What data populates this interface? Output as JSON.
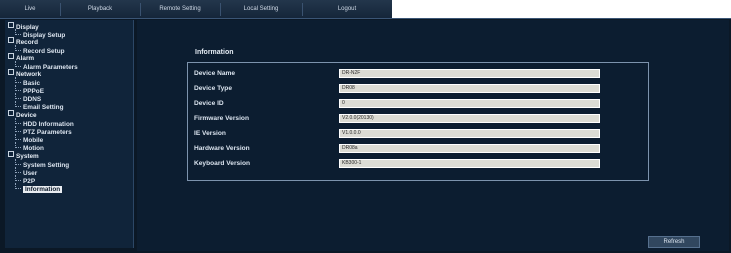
{
  "topnav": {
    "tabs": [
      "Live",
      "Playback",
      "Remote Setting",
      "Local Setting",
      "Logout"
    ]
  },
  "sidebar": {
    "items": [
      {
        "label": "Display",
        "kind": "cat"
      },
      {
        "label": "Display Setup",
        "kind": "sub"
      },
      {
        "label": "Record",
        "kind": "cat"
      },
      {
        "label": "Record Setup",
        "kind": "sub"
      },
      {
        "label": "Alarm",
        "kind": "cat"
      },
      {
        "label": "Alarm Parameters",
        "kind": "sub"
      },
      {
        "label": "Network",
        "kind": "cat"
      },
      {
        "label": "Basic",
        "kind": "sub"
      },
      {
        "label": "PPPoE",
        "kind": "sub"
      },
      {
        "label": "DDNS",
        "kind": "sub"
      },
      {
        "label": "Email Setting",
        "kind": "sub"
      },
      {
        "label": "Device",
        "kind": "cat"
      },
      {
        "label": "HDD Information",
        "kind": "sub"
      },
      {
        "label": "PTZ Parameters",
        "kind": "sub"
      },
      {
        "label": "Mobile",
        "kind": "sub"
      },
      {
        "label": "Motion",
        "kind": "sub"
      },
      {
        "label": "System",
        "kind": "cat"
      },
      {
        "label": "System Setting",
        "kind": "sub"
      },
      {
        "label": "User",
        "kind": "sub"
      },
      {
        "label": "P2P",
        "kind": "sub"
      },
      {
        "label": "Information",
        "kind": "sub",
        "active": true
      }
    ]
  },
  "main": {
    "section_title": "Information",
    "fields": [
      {
        "label": "Device Name",
        "value": "DR-N2F"
      },
      {
        "label": "Device Type",
        "value": "DR08"
      },
      {
        "label": "Device ID",
        "value": "0"
      },
      {
        "label": "Firmware Version",
        "value": "V2.0.0(20130)"
      },
      {
        "label": "IE Version",
        "value": "V1.0.0.0"
      },
      {
        "label": "Hardware Version",
        "value": "DR08a"
      },
      {
        "label": "Keyboard Version",
        "value": "KB300-1"
      }
    ],
    "refresh_label": "Refresh"
  },
  "colors": {
    "background": "#0b1826",
    "sidebar": "#10243a",
    "field_bg": "#dcdcd4",
    "text": "#dbe4ef"
  }
}
